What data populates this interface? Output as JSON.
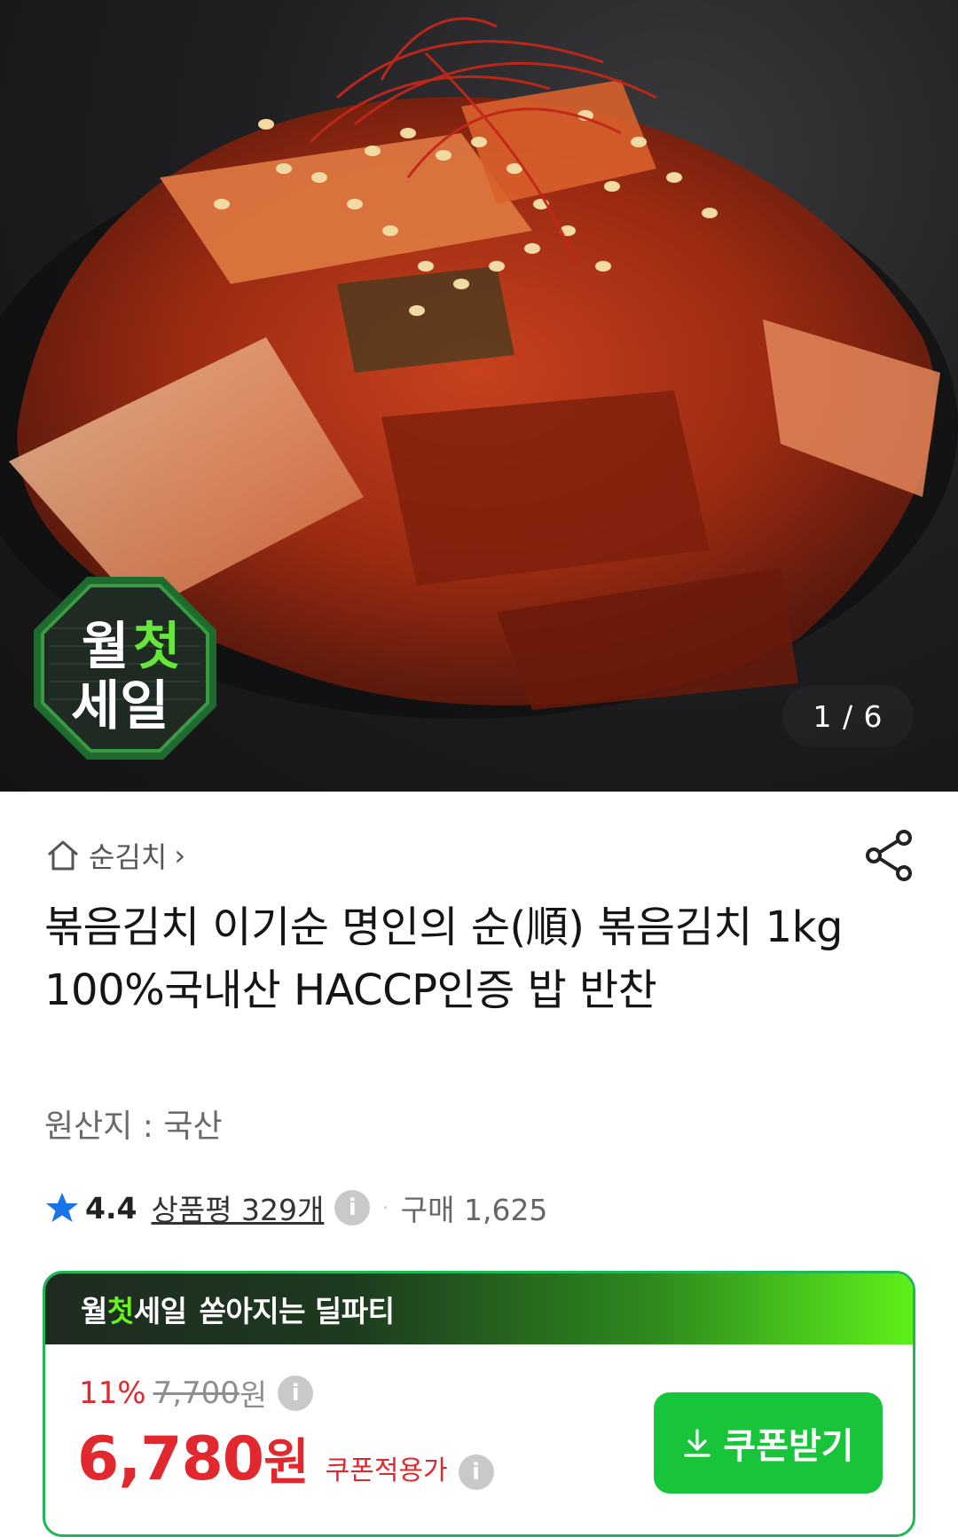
{
  "hero": {
    "badge_line1_a": "월",
    "badge_line1_b": "첫",
    "badge_line2": "세일",
    "image_counter": "1 / 6"
  },
  "breadcrumb": {
    "category": "순김치",
    "chevron": "›"
  },
  "product": {
    "title": "볶음김치 이기순 명인의 순(順) 볶음김치 1kg 100%국내산 HACCP인증 밥 반찬",
    "origin": "원산지 : 국산",
    "rating": "4.4",
    "review_label": "상품평 329개",
    "info_glyph": "i",
    "separator": "·",
    "purchase_count": "구매 1,625"
  },
  "sale": {
    "header_a": "월",
    "header_b": "첫",
    "header_c": "세일",
    "header_d": "쏟아지는 딜파티",
    "discount_rate": "11%",
    "original_price": "7,700",
    "original_won": "원",
    "price": "6,780",
    "price_won": "원",
    "coupon_price_label": "쿠폰적용가",
    "coupon_button_label": "쿠폰받기"
  },
  "colors": {
    "sale_red": "#e0282e",
    "coupon_green": "#17c43a",
    "star_blue": "#1a73e8"
  }
}
